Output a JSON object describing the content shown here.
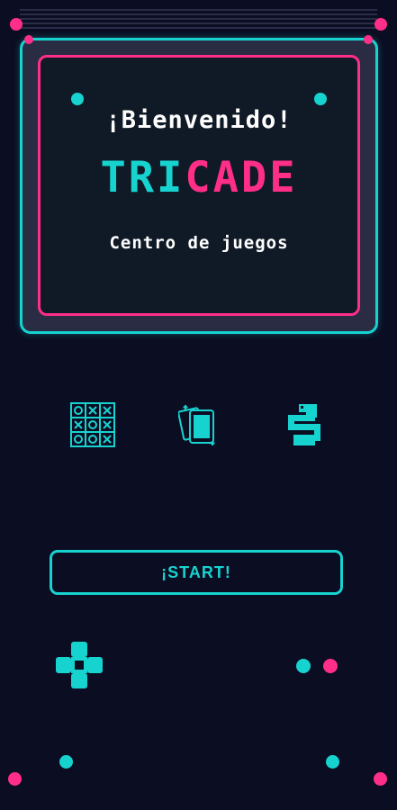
{
  "welcome_text": "¡Bienvenido!",
  "logo": {
    "part1": "TRI",
    "part2": "CADE"
  },
  "subtitle": "Centro de juegos",
  "games": [
    {
      "icon": "tic-tac-toe-icon"
    },
    {
      "icon": "cards-icon"
    },
    {
      "icon": "snake-icon"
    }
  ],
  "start_button": {
    "label": "¡START!"
  },
  "colors": {
    "background": "#0b0d22",
    "cyan": "#17d3d0",
    "pink": "#ff2e88",
    "screen": "#101a26"
  }
}
